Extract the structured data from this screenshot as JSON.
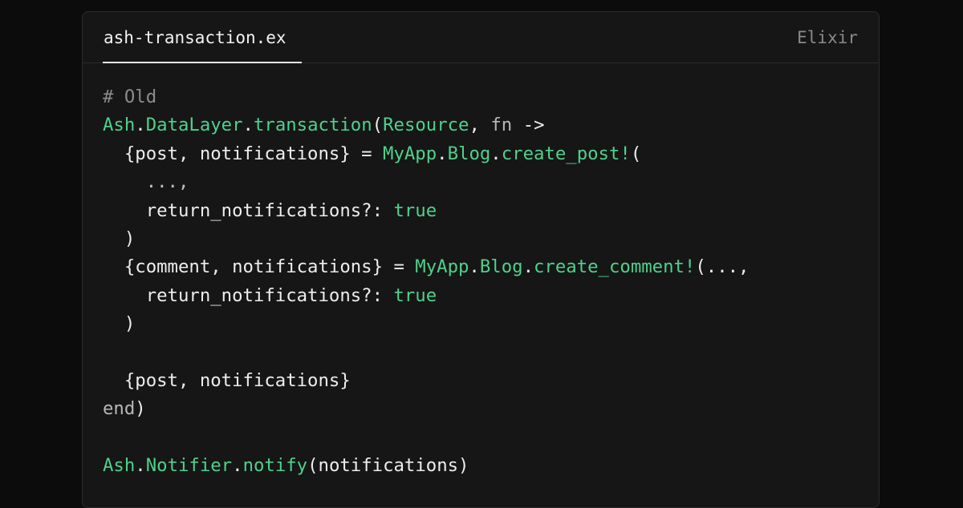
{
  "tab": {
    "filename": "ash-transaction.ex",
    "language": "Elixir"
  },
  "code": {
    "lines": [
      [
        {
          "t": "# Old",
          "c": "comment"
        }
      ],
      [
        {
          "t": "Ash",
          "c": "green"
        },
        {
          "t": ".",
          "c": "plain"
        },
        {
          "t": "DataLayer",
          "c": "green"
        },
        {
          "t": ".",
          "c": "plain"
        },
        {
          "t": "transaction",
          "c": "green"
        },
        {
          "t": "(",
          "c": "plain"
        },
        {
          "t": "Resource",
          "c": "green"
        },
        {
          "t": ", ",
          "c": "plain"
        },
        {
          "t": "fn",
          "c": "kw"
        },
        {
          "t": " ->",
          "c": "plain"
        }
      ],
      [
        {
          "t": "  {post, notifications} = ",
          "c": "plain"
        },
        {
          "t": "MyApp",
          "c": "green"
        },
        {
          "t": ".",
          "c": "plain"
        },
        {
          "t": "Blog",
          "c": "green"
        },
        {
          "t": ".",
          "c": "plain"
        },
        {
          "t": "create_post!",
          "c": "green"
        },
        {
          "t": "(",
          "c": "plain"
        }
      ],
      [
        {
          "t": "    ...,",
          "c": "dim"
        }
      ],
      [
        {
          "t": "    return_notifications?: ",
          "c": "plain"
        },
        {
          "t": "true",
          "c": "green"
        }
      ],
      [
        {
          "t": "  )",
          "c": "plain"
        }
      ],
      [
        {
          "t": "  {comment, notifications} = ",
          "c": "plain"
        },
        {
          "t": "MyApp",
          "c": "green"
        },
        {
          "t": ".",
          "c": "plain"
        },
        {
          "t": "Blog",
          "c": "green"
        },
        {
          "t": ".",
          "c": "plain"
        },
        {
          "t": "create_comment!",
          "c": "green"
        },
        {
          "t": "(...,",
          "c": "plain"
        }
      ],
      [
        {
          "t": "    return_notifications?: ",
          "c": "plain"
        },
        {
          "t": "true",
          "c": "green"
        }
      ],
      [
        {
          "t": "  )",
          "c": "plain"
        }
      ],
      [],
      [
        {
          "t": "  {post, notifications}",
          "c": "plain"
        }
      ],
      [
        {
          "t": "end",
          "c": "kw"
        },
        {
          "t": ")",
          "c": "plain"
        }
      ],
      [],
      [
        {
          "t": "Ash",
          "c": "green"
        },
        {
          "t": ".",
          "c": "plain"
        },
        {
          "t": "Notifier",
          "c": "green"
        },
        {
          "t": ".",
          "c": "plain"
        },
        {
          "t": "notify",
          "c": "green"
        },
        {
          "t": "(notifications)",
          "c": "plain"
        }
      ]
    ]
  }
}
